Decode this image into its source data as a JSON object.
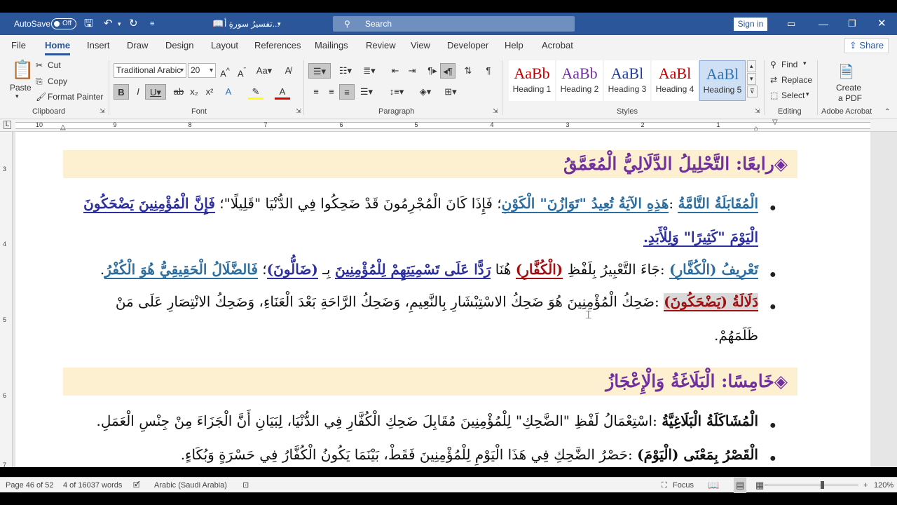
{
  "titlebar": {
    "autosave_label": "AutoSave",
    "autosave_state": "Off",
    "doc_title": "تفسيرُ سورةِ أ...",
    "search_placeholder": "Search",
    "signin_label": "Sign in"
  },
  "tabs": [
    "File",
    "Home",
    "Insert",
    "Draw",
    "Design",
    "Layout",
    "References",
    "Mailings",
    "Review",
    "View",
    "Developer",
    "Help",
    "Acrobat"
  ],
  "share_label": "Share",
  "ribbon": {
    "clipboard": {
      "paste": "Paste",
      "cut": "Cut",
      "copy": "Copy",
      "format_painter": "Format Painter",
      "group": "Clipboard"
    },
    "font": {
      "family": "Traditional Arabic",
      "size": "20",
      "group": "Font"
    },
    "paragraph": {
      "group": "Paragraph"
    },
    "styles": {
      "group": "Styles",
      "items": [
        {
          "sample": "AaBb",
          "name": "Heading 1",
          "color": "#c00000"
        },
        {
          "sample": "AaBb",
          "name": "Heading 2",
          "color": "#7030a0"
        },
        {
          "sample": "AaBl",
          "name": "Heading 3",
          "color": "#1f3d99"
        },
        {
          "sample": "AaBl",
          "name": "Heading 4",
          "color": "#c00000"
        },
        {
          "sample": "AaBl",
          "name": "Heading 5",
          "color": "#2e74b5"
        }
      ]
    },
    "editing": {
      "find": "Find",
      "replace": "Replace",
      "select": "Select",
      "group": "Editing"
    },
    "acrobat": {
      "create_pdf_1": "Create",
      "create_pdf_2": "a PDF",
      "group": "Adobe Acrobat"
    }
  },
  "ruler": {
    "h_numbers": [
      "10",
      "9",
      "8",
      "7",
      "6",
      "5",
      "4",
      "3",
      "2",
      "1"
    ],
    "v_numbers": [
      "3",
      "4",
      "5",
      "6",
      "7"
    ]
  },
  "document": {
    "section4_title": "◈رابعًا: التَّحْلِيلُ الدَّلَالِيُّ الْمُعَمَّقُ",
    "bullet1": {
      "term": "الْمُقَابَلَةُ التَّامَّةُ",
      "p1": " :",
      "p2": "هَذِهِ الآيَةُ تُعِيدُ \"تَوَازُنَ\" الْكَوْنِ",
      "p3": "؛ فَإِذَا كَانَ الْمُجْرِمُونَ قَدْ ضَحِكُوا فِي الدُّنْيَا \"قَلِيلًا\"؛ ",
      "p4": "فَإِنَّ الْمُؤْمِنِينَ يَضْحَكُونَ",
      "line2": "الْيَوْمَ \"كَثِيرًا\" وَلِلْأَبَدِ."
    },
    "bullet2": {
      "term": "تَعْرِيفُ (الْكُفَّارِ)",
      "p1": " :جَاءَ التَّعْبِيرُ بِلَفْظِ ",
      "p2": "(الْكُفَّارِ)",
      "p3": " هُنَا ",
      "p4": "رَدًّا عَلَى تَسْمِيَتِهِمْ لِلْمُؤْمِنِينَ",
      "p5": " بِـ ",
      "p6": "(ضَالُّونَ)",
      "p7": "؛ ",
      "p8": "فَالضَّلَالُ الْحَقِيقِيُّ هُوَ الْكُفْرُ",
      "p9": "."
    },
    "bullet3": {
      "term": "دَلَالَةُ (يَضْحَكُونَ)",
      "p1": " :ضَحِكُ الْمُؤْمِنِينَ هُوَ ضَحِكُ الاسْتِبْشَارِ بِالنَّعِيمِ، وَضَحِكُ الرَّاحَةِ بَعْدَ الْعَنَاءِ، وَضَحِكُ الانْتِصَارِ عَلَى مَنْ",
      "line2": "ظَلَمَهُمْ."
    },
    "section5_title": "◈خَامِسًا: الْبَلَاغَةُ وَالْإِعْجَازُ",
    "bullet4": {
      "term": "الْمُشَاكَلَةُ الْبَلَاغِيَّةُ",
      "p1": " :اسْتِعْمَالُ لَفْظِ \"الضَّحِكِ\" لِلْمُؤْمِنِينَ مُقَابِلَ ضَحِكِ الْكُفَّارِ فِي الدُّنْيَا، لِبَيَانِ أَنَّ الْجَزَاءَ مِنْ جِنْسِ الْعَمَلِ."
    },
    "bullet5": {
      "term": "الْقَصْرُ بِمَعْنَى (الْيَوْمَ)",
      "p1": " :حَصْرُ الضَّحِكِ فِي هَذَا الْيَوْمِ لِلْمُؤْمِنِينَ فَقَطْ، بَيْنَمَا يَكُونُ الْكُفَّارُ فِي حَسْرَةٍ وَبُكَاءٍ."
    }
  },
  "statusbar": {
    "page": "Page 46 of 52",
    "words": "4 of 16037 words",
    "language": "Arabic (Saudi Arabia)",
    "focus": "Focus",
    "zoom": "120%",
    "zoom_fraction": 0.6
  }
}
